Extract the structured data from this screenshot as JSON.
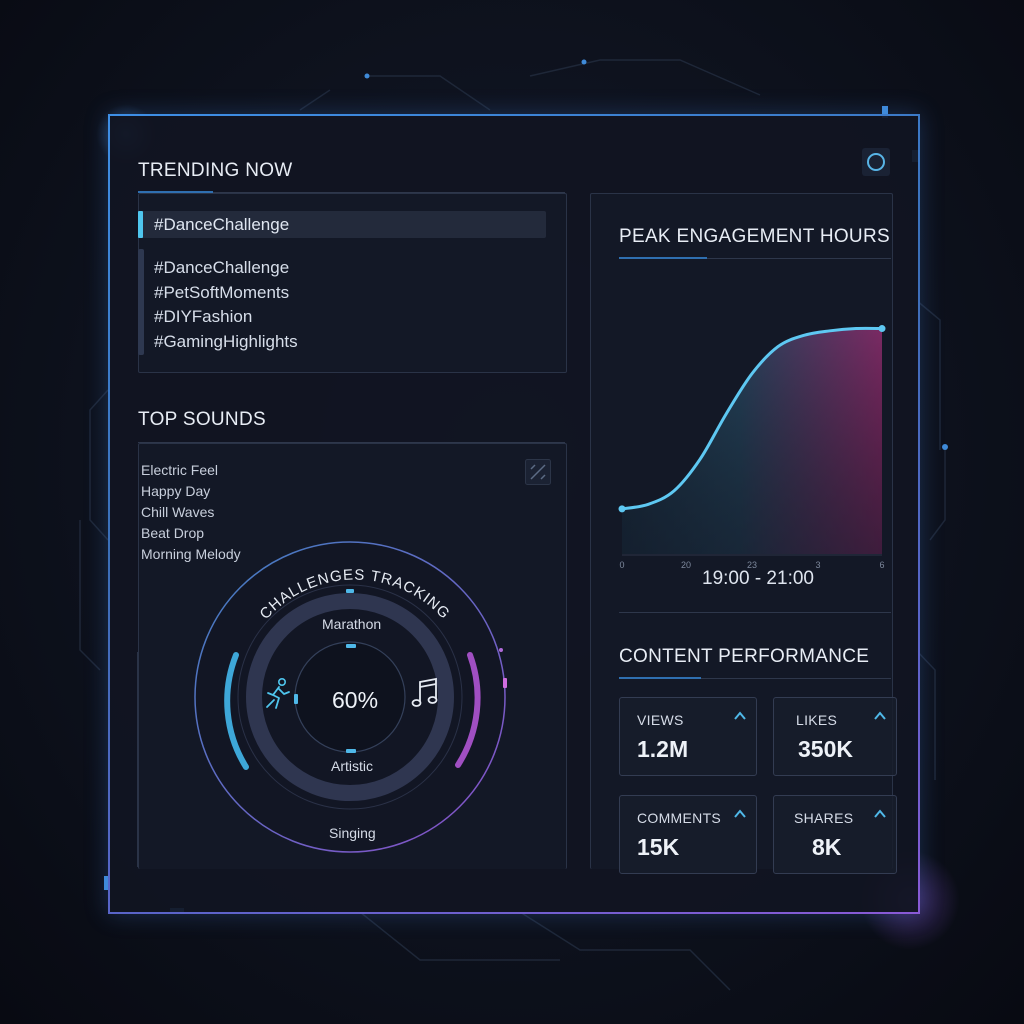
{
  "trending": {
    "title": "TRENDING NOW",
    "selected": "#DanceChallenge",
    "items": [
      "#DanceChallenge",
      "#PetSoftMoments",
      "#DIYFashion",
      "#GamingHighlights"
    ]
  },
  "sounds": {
    "title": "TOP SOUNDS",
    "items": [
      "Electric Feel",
      "Happy Day",
      "Chill Waves",
      "Beat Drop",
      "Morning Melody"
    ]
  },
  "challenges": {
    "title": "CHALLENGES TRACKING",
    "center_value": "60%",
    "labels": {
      "top": "Marathon",
      "middle": "Artistic",
      "bottom": "Singing"
    },
    "icons": {
      "left": "running-icon",
      "right": "music-note-icon"
    }
  },
  "engagement": {
    "title": "PEAK ENGAGEMENT HOURS",
    "peak_range": "19:00 - 21:00",
    "x_ticks": [
      "0",
      "20",
      "23",
      "3",
      "6"
    ]
  },
  "chart_data": {
    "type": "area",
    "title": "PEAK ENGAGEMENT HOURS",
    "x": [
      0,
      1,
      2,
      3,
      4,
      5,
      6,
      7,
      8,
      9,
      10
    ],
    "values": [
      0.2,
      0.22,
      0.28,
      0.42,
      0.62,
      0.8,
      0.92,
      0.97,
      0.99,
      1.0,
      1.0
    ],
    "tick_labels": [
      "0",
      "20",
      "23",
      "3",
      "6"
    ],
    "annotation": "19:00 - 21:00",
    "ylim": [
      0,
      1.1
    ],
    "grid": false,
    "colors": {
      "line": "#5ec8f2",
      "fill_start": "#1f3a52",
      "fill_end": "#7a2a63"
    }
  },
  "performance": {
    "title": "CONTENT PERFORMANCE",
    "tiles": [
      {
        "label": "VIEWS",
        "value": "1.2M"
      },
      {
        "label": "LIKES",
        "value": "350K"
      },
      {
        "label": "COMMENTS",
        "value": "15K"
      },
      {
        "label": "SHARES",
        "value": "8K"
      }
    ]
  },
  "header": {
    "icon": "circle-icon"
  },
  "colors": {
    "accent": "#4fb8e8",
    "purple": "#a45fd0",
    "frame": "#3e8fe6",
    "background": "#0d111c"
  }
}
